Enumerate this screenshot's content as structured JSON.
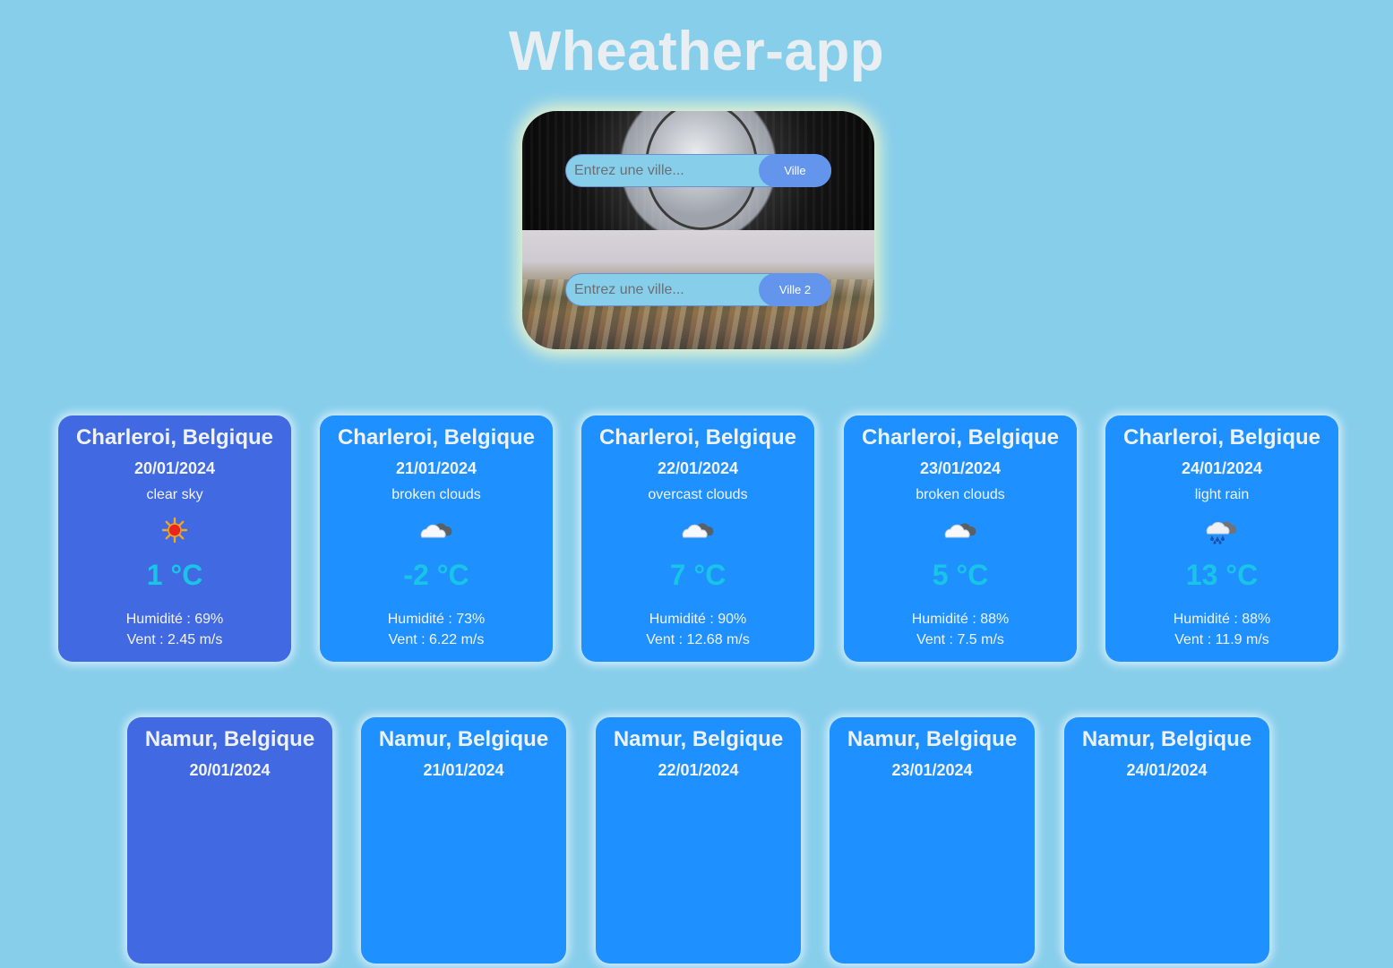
{
  "app": {
    "title": "Wheather-app"
  },
  "search": {
    "first": {
      "placeholder": "Entrez une ville...",
      "button_label": "Ville"
    },
    "second": {
      "placeholder": "Entrez une ville...",
      "button_label": "Ville 2"
    }
  },
  "colors": {
    "background": "#87ceeb",
    "card": "#1e90ff",
    "card_active": "#4169e1",
    "temperature": "#19c5e6",
    "button": "#6495ed"
  },
  "forecast_1": [
    {
      "city": "Charleroi, Belgique",
      "date": "20/01/2024",
      "description": "clear sky",
      "icon": "sun-icon",
      "temperature": "1 °C",
      "humidity": "Humidité : 69%",
      "wind": "Vent : 2.45 m/s",
      "active": true
    },
    {
      "city": "Charleroi, Belgique",
      "date": "21/01/2024",
      "description": "broken clouds",
      "icon": "broken-clouds-icon",
      "temperature": "-2 °C",
      "humidity": "Humidité : 73%",
      "wind": "Vent : 6.22 m/s",
      "active": false
    },
    {
      "city": "Charleroi, Belgique",
      "date": "22/01/2024",
      "description": "overcast clouds",
      "icon": "broken-clouds-icon",
      "temperature": "7 °C",
      "humidity": "Humidité : 90%",
      "wind": "Vent : 12.68 m/s",
      "active": false
    },
    {
      "city": "Charleroi, Belgique",
      "date": "23/01/2024",
      "description": "broken clouds",
      "icon": "broken-clouds-icon",
      "temperature": "5 °C",
      "humidity": "Humidité : 88%",
      "wind": "Vent : 7.5 m/s",
      "active": false
    },
    {
      "city": "Charleroi, Belgique",
      "date": "24/01/2024",
      "description": "light rain",
      "icon": "rain-icon",
      "temperature": "13 °C",
      "humidity": "Humidité : 88%",
      "wind": "Vent : 11.9 m/s",
      "active": false
    }
  ],
  "forecast_2": [
    {
      "city": "Namur, Belgique",
      "date": "20/01/2024",
      "active": true
    },
    {
      "city": "Namur, Belgique",
      "date": "21/01/2024",
      "active": false
    },
    {
      "city": "Namur, Belgique",
      "date": "22/01/2024",
      "active": false
    },
    {
      "city": "Namur, Belgique",
      "date": "23/01/2024",
      "active": false
    },
    {
      "city": "Namur, Belgique",
      "date": "24/01/2024",
      "active": false
    }
  ]
}
